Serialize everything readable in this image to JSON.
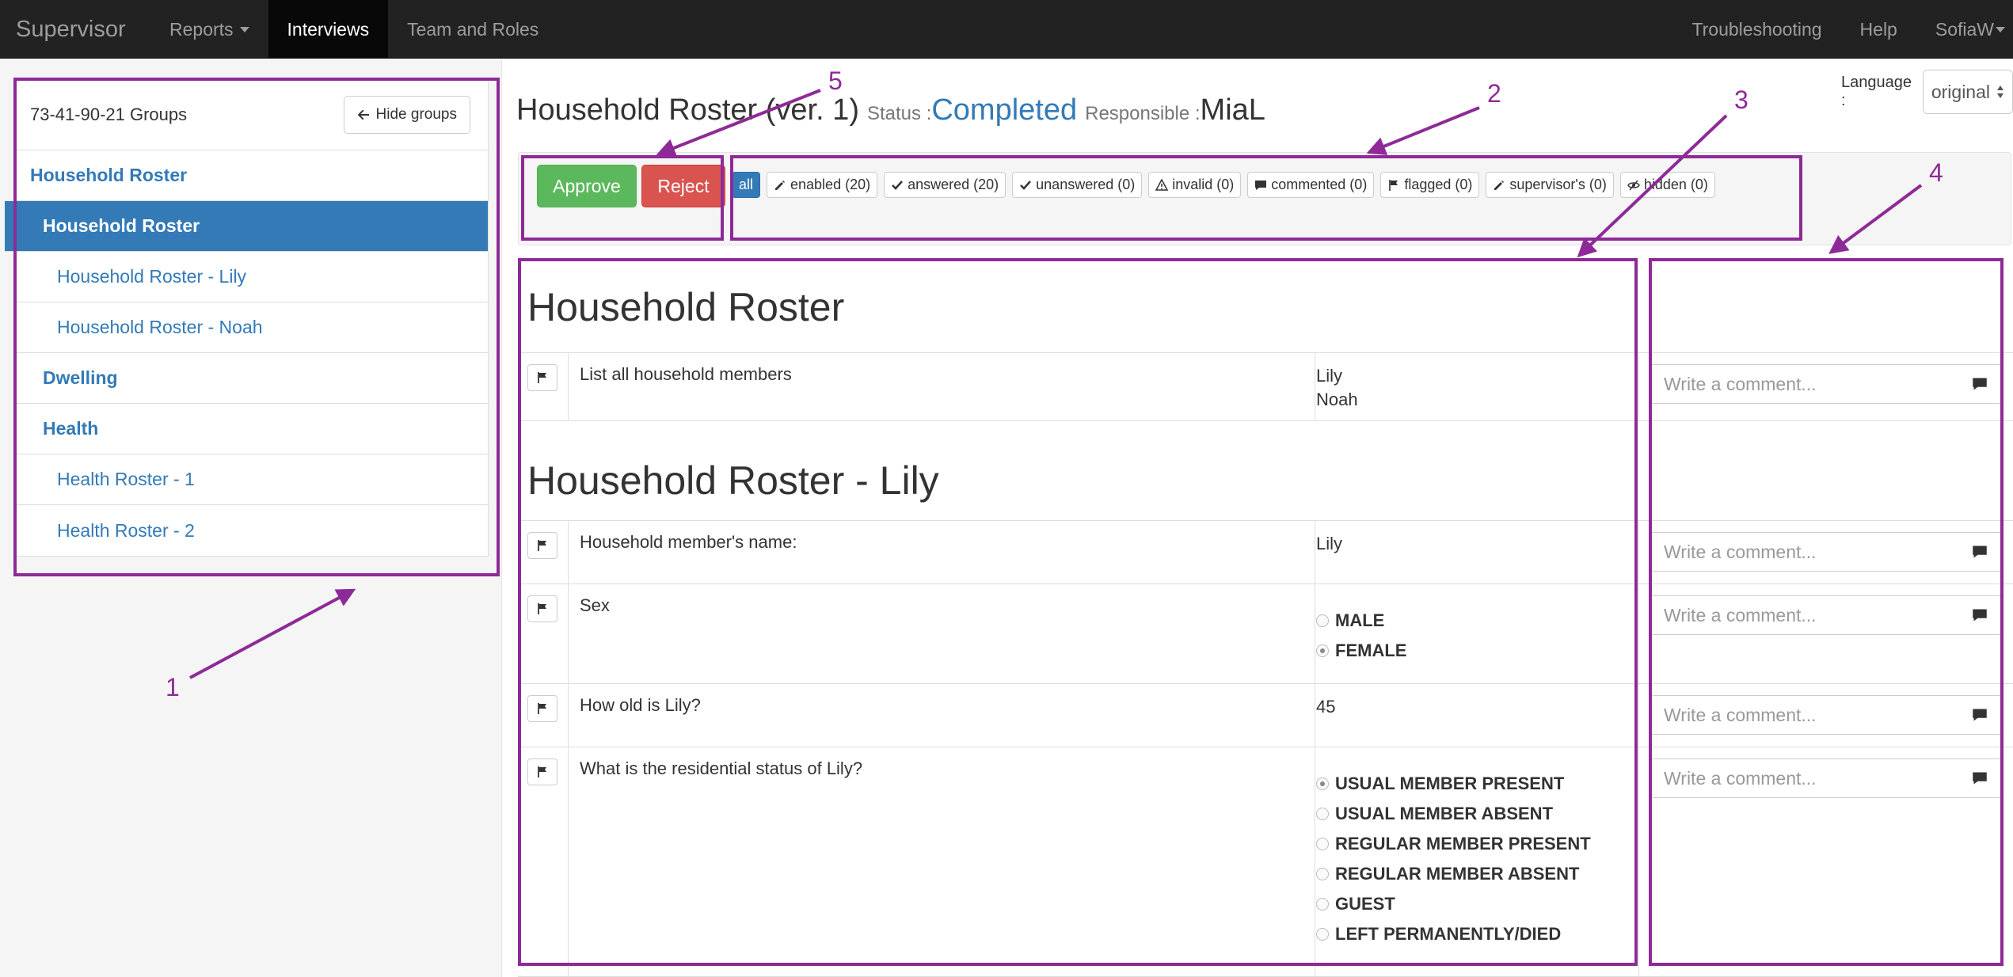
{
  "nav": {
    "brand": "Supervisor",
    "reports": "Reports",
    "interviews": "Interviews",
    "team_roles": "Team and Roles",
    "troubleshooting": "Troubleshooting",
    "help": "Help",
    "user": "SofiaW"
  },
  "sidebar": {
    "groups_title": "73-41-90-21 Groups",
    "hide_groups": "Hide groups",
    "items": [
      {
        "label": "Household Roster"
      },
      {
        "label": "Household Roster"
      },
      {
        "label": "Household Roster - Lily"
      },
      {
        "label": "Household Roster - Noah"
      },
      {
        "label": "Dwelling"
      },
      {
        "label": "Health"
      },
      {
        "label": "Health Roster - 1"
      },
      {
        "label": "Health Roster - 2"
      }
    ]
  },
  "header": {
    "title": "Household Roster (ver. 1)",
    "status_label": "Status :",
    "status_value": "Completed",
    "responsible_label": "Responsible :",
    "responsible_value": "MiaL"
  },
  "language": {
    "label": "Language :",
    "value": "original"
  },
  "actions": {
    "approve": "Approve",
    "reject": "Reject"
  },
  "filters": [
    {
      "label": "all"
    },
    {
      "label": "enabled (20)",
      "icon": "pencil-icon"
    },
    {
      "label": "answered (20)",
      "icon": "check-icon"
    },
    {
      "label": "unanswered (0)",
      "icon": "check-icon"
    },
    {
      "label": "invalid (0)",
      "icon": "warning-icon"
    },
    {
      "label": "commented (0)",
      "icon": "comment-icon"
    },
    {
      "label": "flagged (0)",
      "icon": "flag-icon"
    },
    {
      "label": "supervisor's (0)",
      "icon": "pencil-icon"
    },
    {
      "label": "hidden (0)",
      "icon": "eye-slash-icon"
    }
  ],
  "sections": [
    {
      "title": "Household Roster",
      "questions": [
        {
          "text": "List all household members",
          "answer_lines": [
            "Lily",
            "Noah"
          ]
        }
      ]
    },
    {
      "title": "Household Roster - Lily",
      "questions": [
        {
          "text": "Household member's name:",
          "answer": "Lily"
        },
        {
          "text": "Sex",
          "options": [
            "MALE",
            "FEMALE"
          ],
          "selected": "FEMALE"
        },
        {
          "text": "How old is Lily?",
          "answer": "45"
        },
        {
          "text": "What is the residential status of Lily?",
          "options": [
            "USUAL MEMBER PRESENT",
            "USUAL MEMBER ABSENT",
            "REGULAR MEMBER PRESENT",
            "REGULAR MEMBER ABSENT",
            "GUEST",
            "LEFT PERMANENTLY/DIED"
          ],
          "selected": "USUAL MEMBER PRESENT"
        }
      ]
    }
  ],
  "comment_placeholder": "Write a comment...",
  "annotations": {
    "color": "#8e2a97",
    "labels": [
      "1",
      "2",
      "3",
      "4",
      "5"
    ]
  },
  "colors": {
    "primary": "#337ab7",
    "approve": "#5cb85c",
    "reject": "#d9534f",
    "navbar": "#222222"
  }
}
